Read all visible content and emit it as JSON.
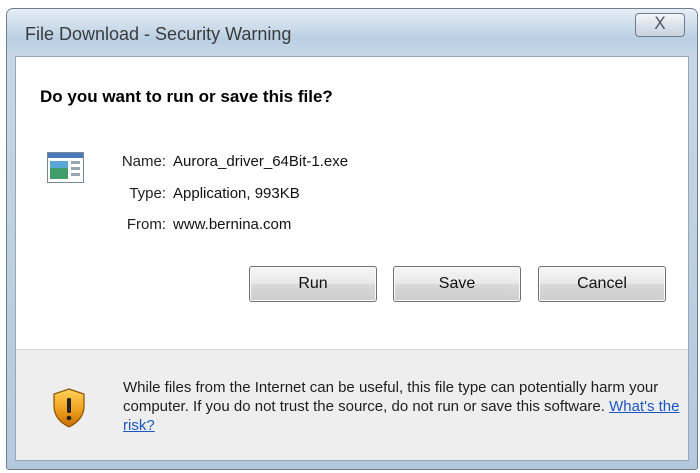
{
  "window": {
    "title": "File Download - Security Warning",
    "close_label": "X"
  },
  "dialog": {
    "question": "Do you want to run or save this file?",
    "file_icon": "application-file-icon",
    "fields": {
      "name_label": "Name:",
      "name_value": "Aurora_driver_64Bit-1.exe",
      "type_label": "Type:",
      "type_value": "Application, 993KB",
      "from_label": "From:",
      "from_value": "www.bernina.com"
    },
    "buttons": {
      "run": "Run",
      "save": "Save",
      "cancel": "Cancel"
    }
  },
  "warning": {
    "icon": "security-shield-icon",
    "text": "While files from the Internet can be useful, this file type can potentially harm your computer. If you do not trust the source, do not run or save this software.",
    "link_text": "What's the risk?"
  },
  "colors": {
    "link": "#1a56c2",
    "shield_orange": "#e8900a"
  }
}
